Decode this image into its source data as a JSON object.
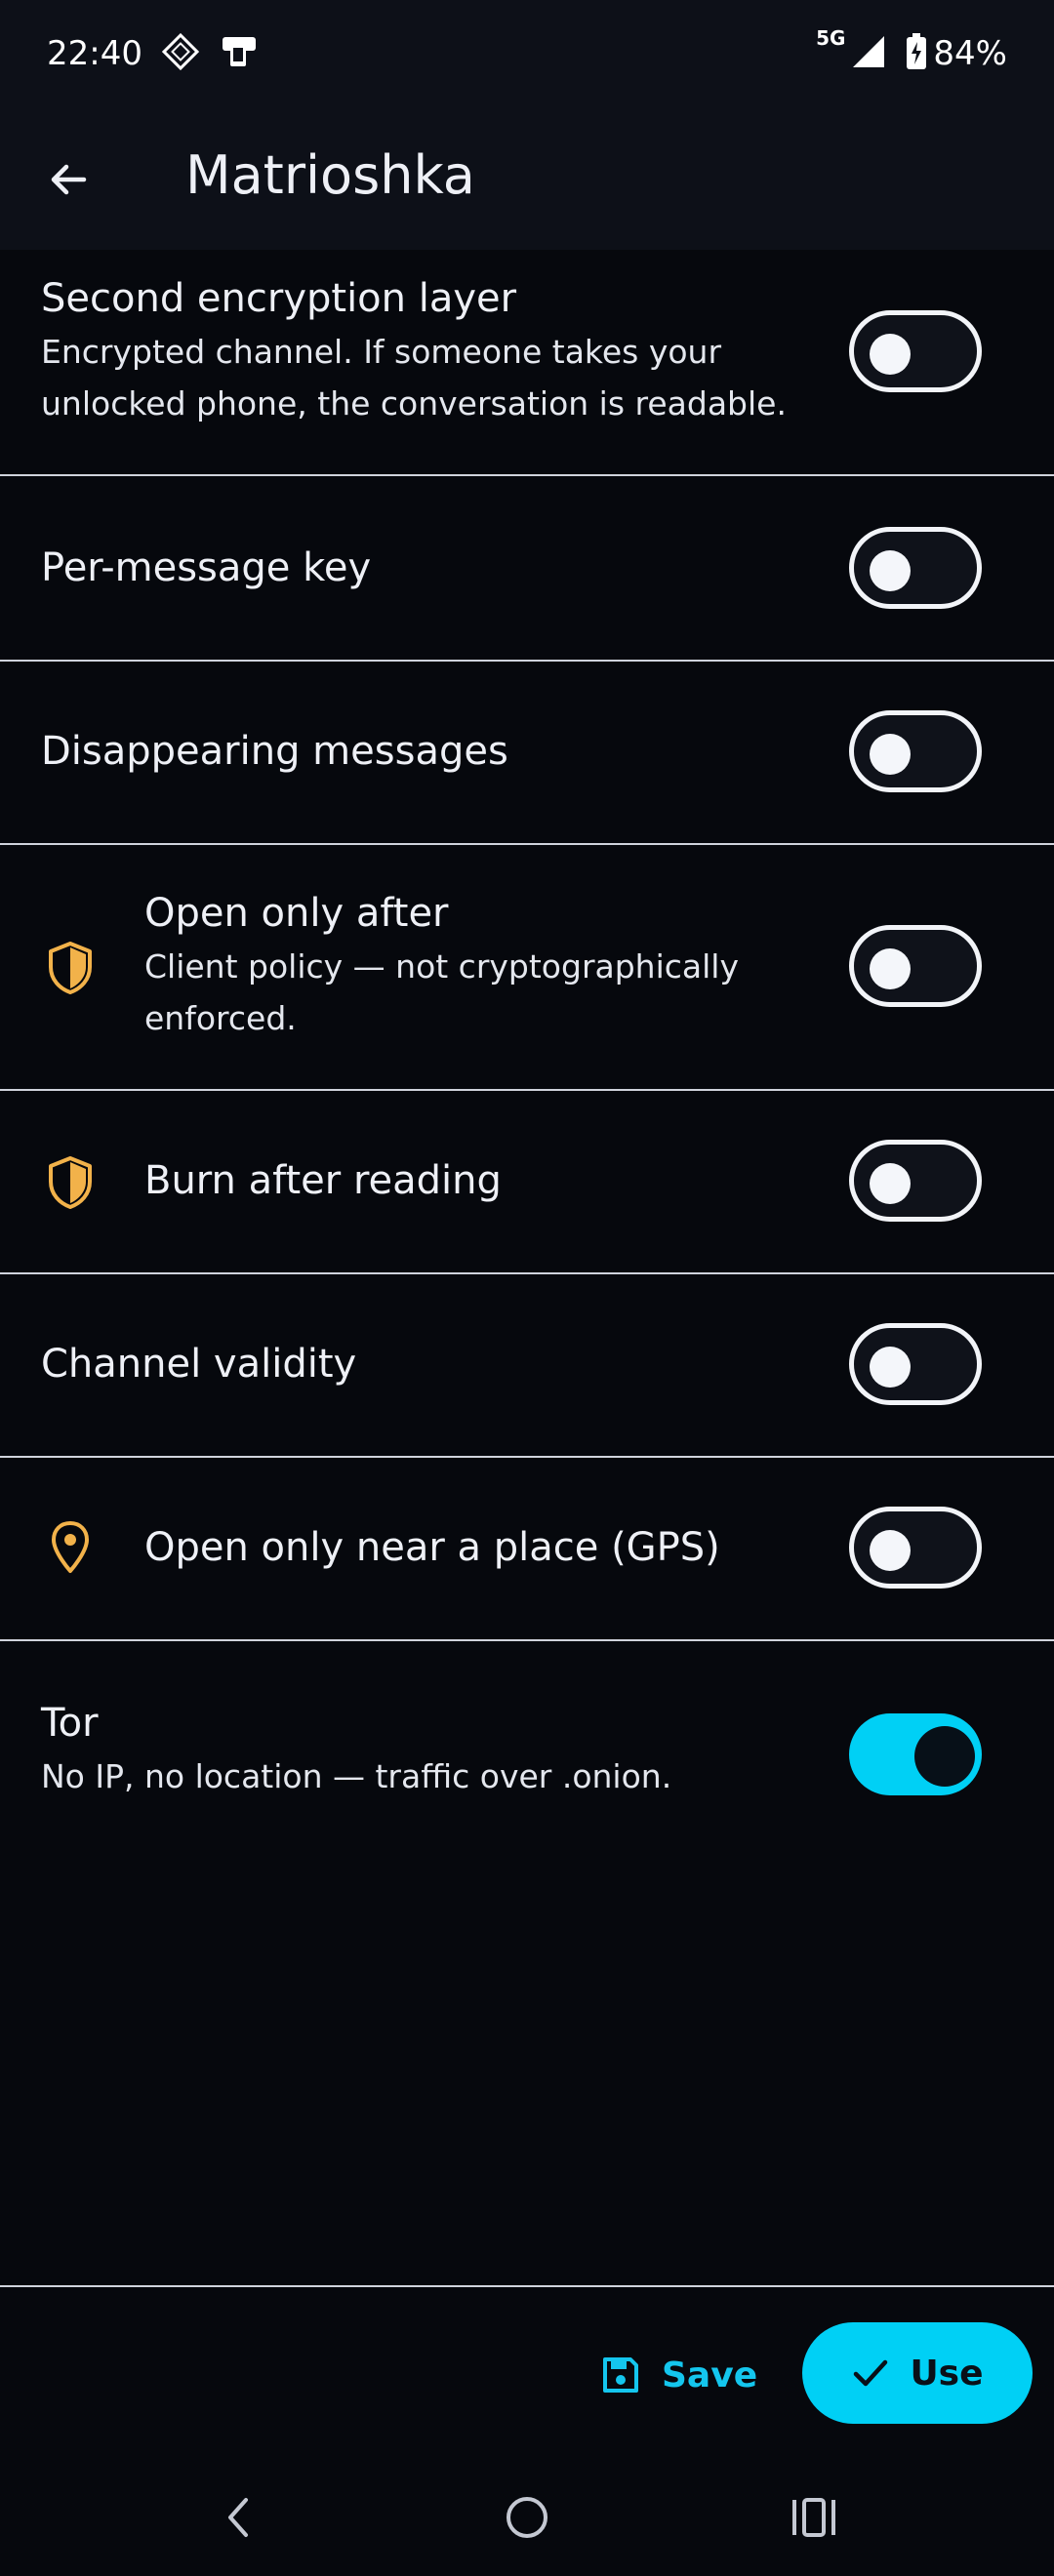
{
  "status_bar": {
    "time": "22:40",
    "network": "5G",
    "battery": "84%"
  },
  "app_bar": {
    "title": "Matrioshka"
  },
  "settings": [
    {
      "title": "Second encryption layer",
      "subtitle": "Encrypted channel. If someone takes your unlocked phone, the conversation is readable.",
      "enabled": false
    },
    {
      "title": "Per-message key",
      "enabled": false
    },
    {
      "title": "Disappearing messages",
      "enabled": false
    },
    {
      "title": "Open only after",
      "subtitle": "Client policy — not cryptographically enforced.",
      "icon": "shield-icon",
      "enabled": false
    },
    {
      "title": "Burn after reading",
      "icon": "shield-icon",
      "enabled": false
    },
    {
      "title": "Channel validity",
      "enabled": false
    },
    {
      "title": "Open only near a place (GPS)",
      "icon": "location-pin-icon",
      "enabled": false
    },
    {
      "title": "Tor",
      "subtitle": "No IP, no location — traffic over .onion.",
      "enabled": true
    }
  ],
  "actions": {
    "save_label": "Save",
    "use_label": "Use"
  },
  "colors": {
    "accent": "#00d0f5",
    "warning_icon": "#f2b24a",
    "background": "#06080d"
  }
}
